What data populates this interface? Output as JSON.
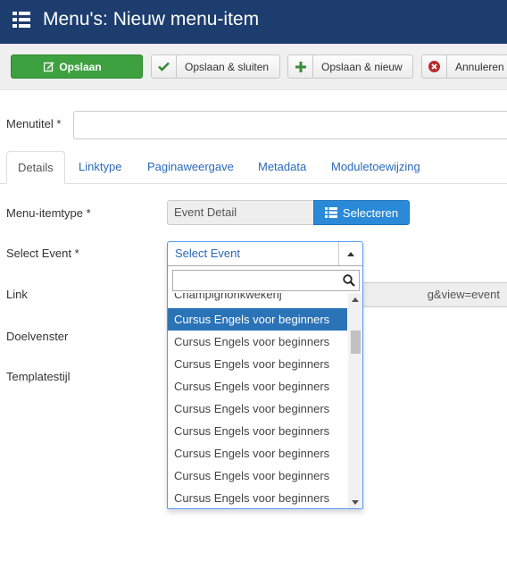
{
  "header": {
    "title": "Menu's: Nieuw menu-item"
  },
  "toolbar": {
    "save": "Opslaan",
    "save_close": "Opslaan & sluiten",
    "save_new": "Opslaan & nieuw",
    "cancel": "Annuleren"
  },
  "form": {
    "menutitle_label": "Menutitel *",
    "menutitle_value": "",
    "tabs": [
      "Details",
      "Linktype",
      "Paginaweergave",
      "Metadata",
      "Moduletoewijzing"
    ],
    "itemtype_label": "Menu-itemtype *",
    "itemtype_value": "Event Detail",
    "select_button": "Selecteren",
    "event_label": "Select Event *",
    "link_label": "Link",
    "link_value": "g&view=event",
    "target_label": "Doelvenster",
    "template_label": "Templatestijl"
  },
  "dropdown": {
    "selected": "Select Event",
    "search_value": "",
    "options": [
      "Champignonkwekerij",
      "Cursus Engels voor beginners",
      "Cursus Engels voor beginners",
      "Cursus Engels voor beginners",
      "Cursus Engels voor beginners",
      "Cursus Engels voor beginners",
      "Cursus Engels voor beginners",
      "Cursus Engels voor beginners",
      "Cursus Engels voor beginners",
      "Cursus Engels voor beginners"
    ],
    "highlighted_index": 1
  },
  "colors": {
    "header": "#1c3d6e",
    "save_button": "#3ea13f",
    "select_button": "#2b8ad8",
    "highlight": "#2b73b7",
    "link": "#2a69b8"
  }
}
